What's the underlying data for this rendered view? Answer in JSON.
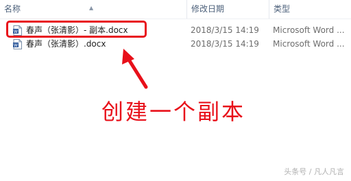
{
  "columns": {
    "name": "名称",
    "date": "修改日期",
    "type": "类型"
  },
  "files": [
    {
      "name": "春声（张清影）- 副本.docx",
      "modified": "2018/3/15 14:19",
      "type": "Microsoft Word ...",
      "icon": "word-doc-icon"
    },
    {
      "name": "春声（张清影）.docx",
      "modified": "2018/3/15 14:19",
      "type": "Microsoft Word ...",
      "icon": "word-doc-icon"
    }
  ],
  "annotation": {
    "text": "创建一个副本",
    "color": "#e8101a"
  },
  "watermark": "头条号 / 凡人凡言"
}
